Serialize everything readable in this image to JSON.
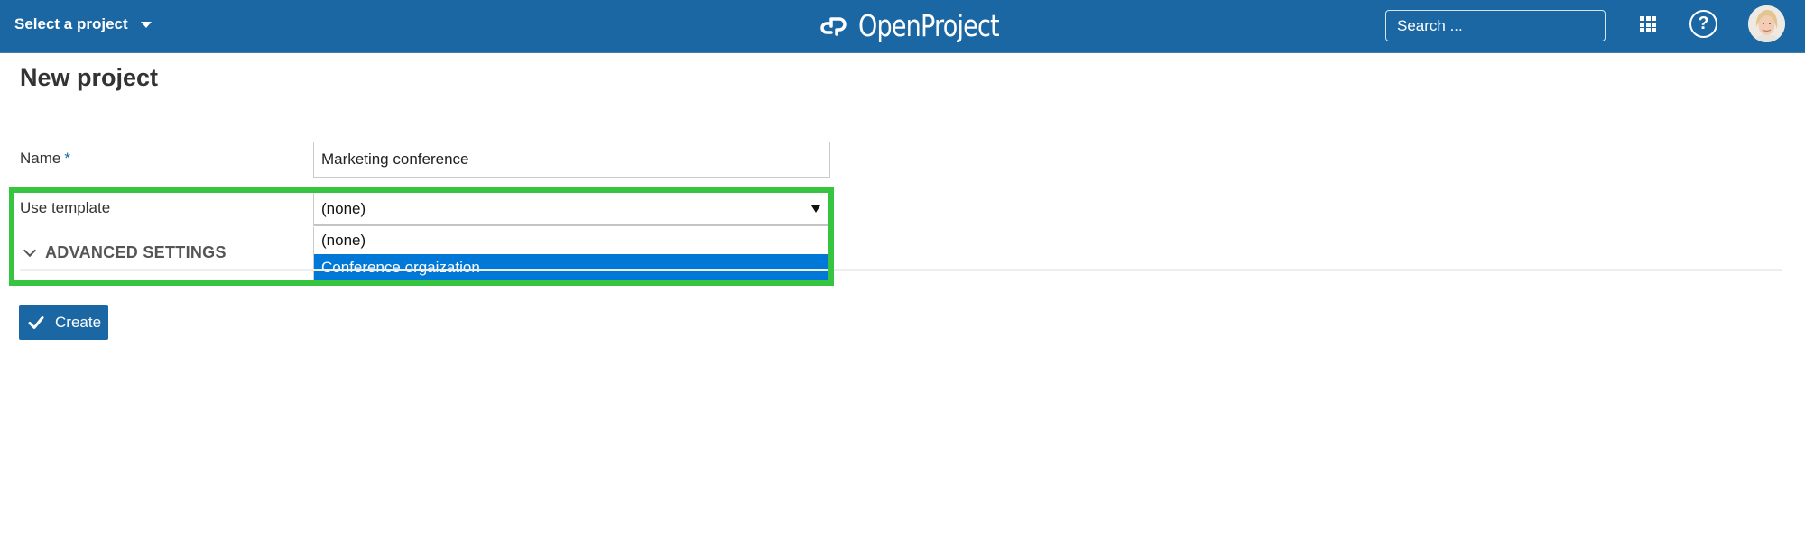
{
  "header": {
    "project_selector_label": "Select a project",
    "logo_text": "OpenProject",
    "search_placeholder": "Search ...",
    "icons": {
      "project_caret": "caret-down-icon",
      "logo": "openproject-logo-icon",
      "search": "search-icon",
      "modules": "grid-icon",
      "help": "help-icon",
      "avatar": "user-avatar"
    },
    "help_glyph": "?"
  },
  "page": {
    "title": "New project"
  },
  "form": {
    "name": {
      "label": "Name",
      "required_marker": "*",
      "value": "Marketing conference"
    },
    "template": {
      "label": "Use template",
      "selected_value": "(none)",
      "options": [
        {
          "label": "(none)",
          "highlighted": false
        },
        {
          "label": "Conference orgaization",
          "highlighted": true
        }
      ]
    },
    "advanced_settings_label": "ADVANCED SETTINGS",
    "create_button_label": "Create"
  },
  "colors": {
    "header_bg": "#1a67a3",
    "primary_button": "#1a67a3",
    "option_highlight": "#0078d7",
    "annotation_box": "#37c441"
  }
}
